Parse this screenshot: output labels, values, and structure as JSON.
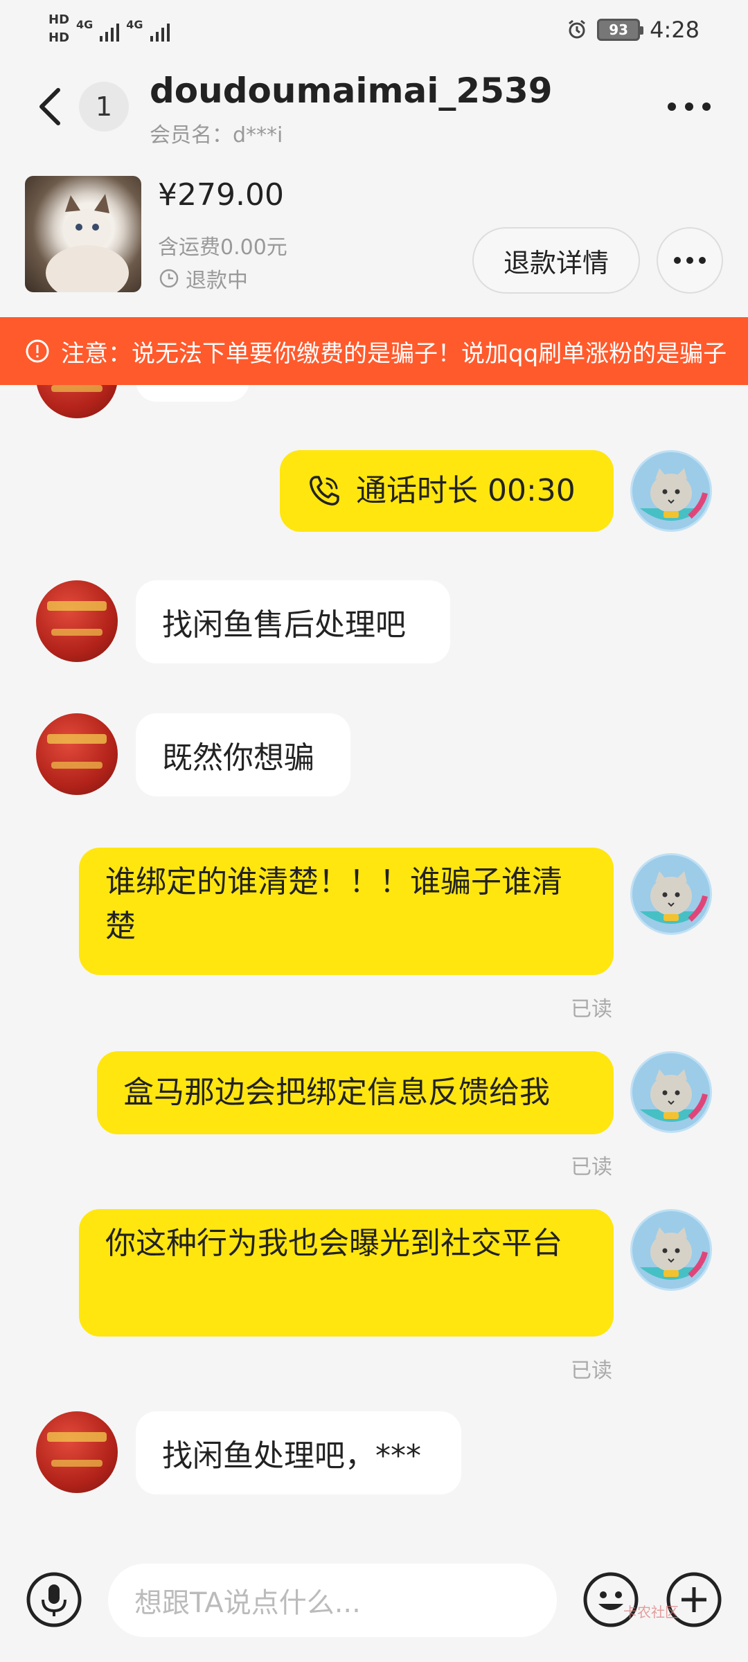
{
  "status_bar": {
    "hd1": "HD",
    "hd2": "HD",
    "net1": "4G",
    "net2": "4G",
    "battery": "93",
    "time": "4:28"
  },
  "header": {
    "unread_count": "1",
    "title": "doudoumaimai_2539",
    "member_name": "会员名：d***i"
  },
  "product": {
    "price": "¥279.00",
    "shipping": "含运费0.00元",
    "status": "退款中",
    "refund_button": "退款详情"
  },
  "warning": {
    "text": "注意：说无法下单要你缴费的是骗子！说加qq刷单涨粉的是骗子"
  },
  "messages": [
    {
      "side": "right",
      "type": "call",
      "text": "通话时长 00:30"
    },
    {
      "side": "left",
      "text": "找闲鱼售后处理吧"
    },
    {
      "side": "left",
      "text": "既然你想骗"
    },
    {
      "side": "right",
      "text": "谁绑定的谁清楚！！！谁骗子谁清楚",
      "read": "已读"
    },
    {
      "side": "right",
      "text": "盒马那边会把绑定信息反馈给我",
      "read": "已读"
    },
    {
      "side": "right",
      "text": "你这种行为我也会曝光到社交平台",
      "read": "已读"
    },
    {
      "side": "left",
      "text": "找闲鱼处理吧，***"
    }
  ],
  "input": {
    "placeholder": "想跟TA说点什么..."
  },
  "watermark": "卡农社区",
  "colors": {
    "bubble_self": "#ffe60f",
    "warning_bg": "#ff5a2c",
    "background": "#f5f5f5"
  },
  "icons": [
    "back-icon",
    "more-icon",
    "clock-icon",
    "warning-icon",
    "phone-icon",
    "microphone-icon",
    "emoji-icon",
    "plus-icon",
    "alarm-icon"
  ]
}
